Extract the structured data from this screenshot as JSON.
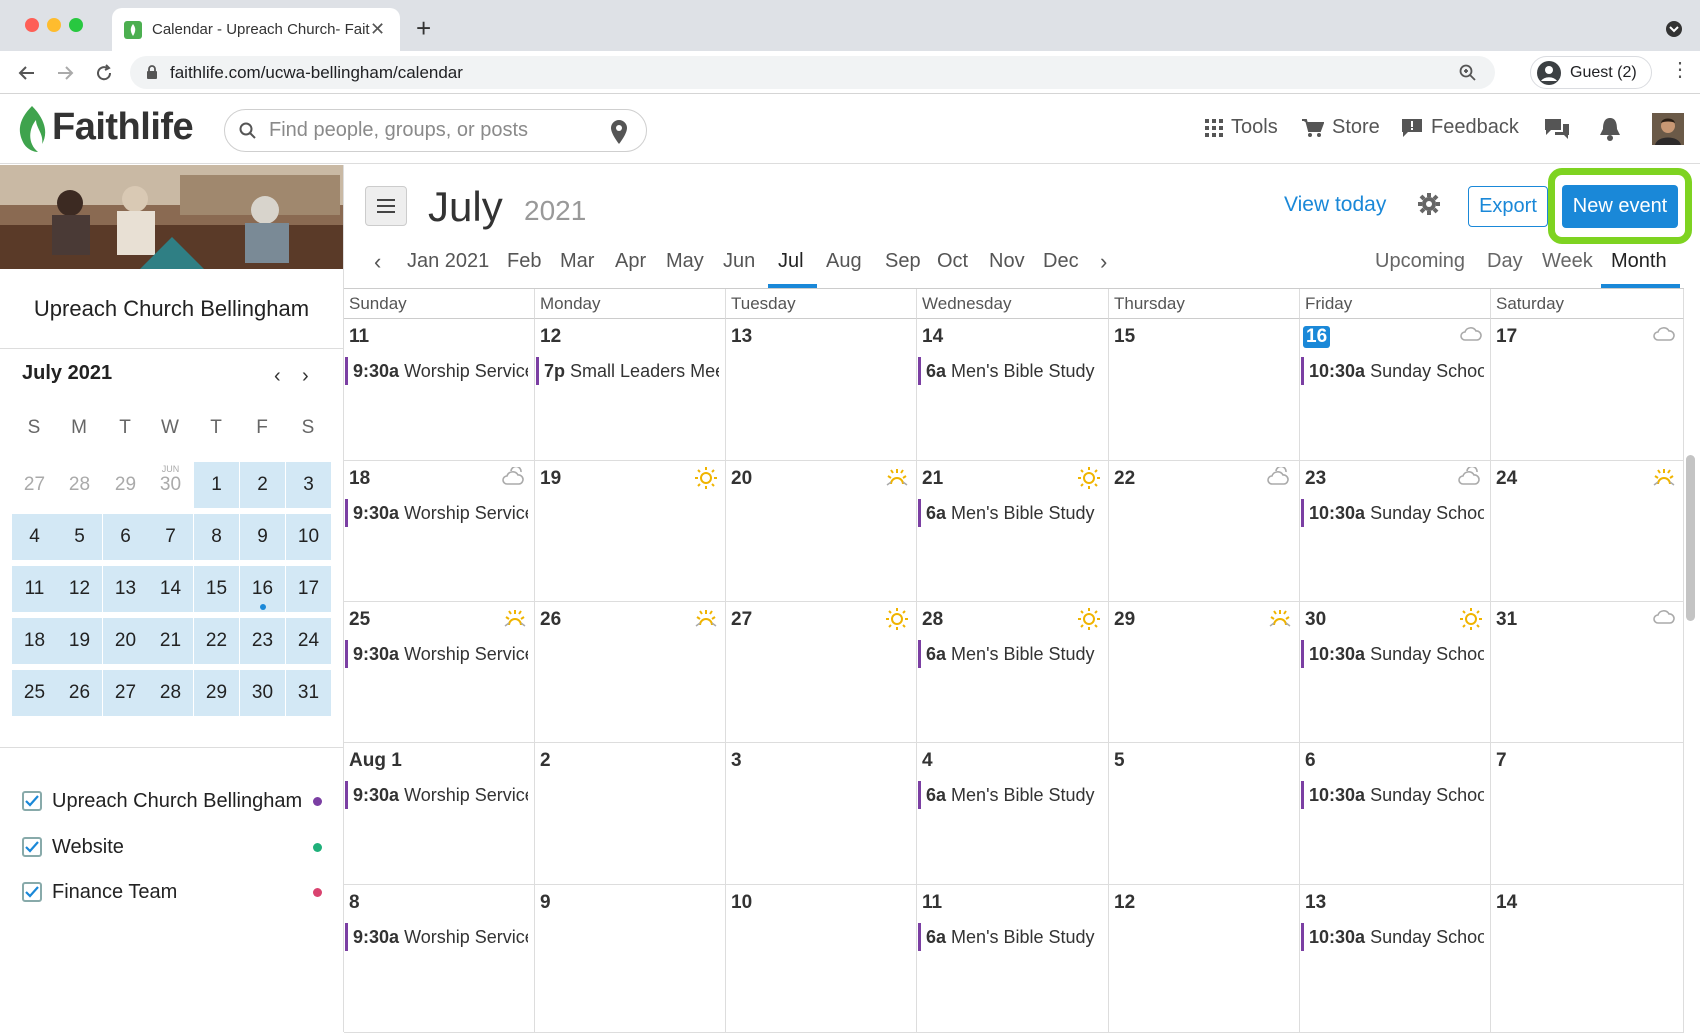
{
  "browser": {
    "tab_title": "Calendar - Upreach Church- Faithlife",
    "url": "faithlife.com/ucwa-bellingham/calendar",
    "guest_label": "Guest (2)"
  },
  "site": {
    "logo": "Faithlife",
    "search_placeholder": "Find people, groups, or posts",
    "nav": {
      "tools": "Tools",
      "store": "Store",
      "feedback": "Feedback"
    },
    "brand_color": "#4caf50",
    "accent_color": "#1a88d8"
  },
  "sidebar": {
    "church_name": "Upreach Church Bellingham",
    "mini_calendar": {
      "title": "July 2021",
      "weekdays": [
        "S",
        "M",
        "T",
        "W",
        "T",
        "F",
        "S"
      ],
      "jun_label": "JUN",
      "weeks": [
        [
          "27",
          "28",
          "29",
          "30",
          "1",
          "2",
          "3"
        ],
        [
          "4",
          "5",
          "6",
          "7",
          "8",
          "9",
          "10"
        ],
        [
          "11",
          "12",
          "13",
          "14",
          "15",
          "16",
          "17"
        ],
        [
          "18",
          "19",
          "20",
          "21",
          "22",
          "23",
          "24"
        ],
        [
          "25",
          "26",
          "27",
          "28",
          "29",
          "30",
          "31"
        ]
      ]
    },
    "calendars": [
      {
        "name": "Upreach Church Bellingham",
        "color": "#7b3fa3",
        "checked": true
      },
      {
        "name": "Website",
        "color": "#1fb07a",
        "checked": true
      },
      {
        "name": "Finance Team",
        "color": "#d9436f",
        "checked": true
      }
    ]
  },
  "calendar": {
    "month": "July",
    "year": "2021",
    "view_today": "View today",
    "export": "Export",
    "new_event": "New event",
    "month_tabs": [
      "Jan 2021",
      "Feb",
      "Mar",
      "Apr",
      "May",
      "Jun",
      "Jul",
      "Aug",
      "Sep",
      "Oct",
      "Nov",
      "Dec"
    ],
    "active_month": "Jul",
    "view_tabs": [
      "Upcoming",
      "Day",
      "Week",
      "Month"
    ],
    "active_view": "Month",
    "weekdays": [
      "Sunday",
      "Monday",
      "Tuesday",
      "Wednesday",
      "Thursday",
      "Friday",
      "Saturday"
    ],
    "weeks": [
      [
        {
          "day": "11",
          "event": {
            "time": "9:30a",
            "title": "Worship Service"
          }
        },
        {
          "day": "12",
          "event": {
            "time": "7p",
            "title": "Small Leaders Meeting"
          }
        },
        {
          "day": "13"
        },
        {
          "day": "14",
          "event": {
            "time": "6a",
            "title": "Men's Bible Study"
          }
        },
        {
          "day": "15"
        },
        {
          "day": "16",
          "today": true,
          "weather": "cloud",
          "event": {
            "time": "10:30a",
            "title": "Sunday School"
          }
        },
        {
          "day": "17",
          "weather": "cloud"
        }
      ],
      [
        {
          "day": "18",
          "weather": "partly-cloudy",
          "event": {
            "time": "9:30a",
            "title": "Worship Service"
          }
        },
        {
          "day": "19",
          "weather": "sun"
        },
        {
          "day": "20",
          "weather": "sunrise"
        },
        {
          "day": "21",
          "weather": "sun",
          "event": {
            "time": "6a",
            "title": "Men's Bible Study"
          }
        },
        {
          "day": "22",
          "weather": "partly-cloudy"
        },
        {
          "day": "23",
          "weather": "partly-cloudy",
          "event": {
            "time": "10:30a",
            "title": "Sunday School"
          }
        },
        {
          "day": "24",
          "weather": "sunrise"
        }
      ],
      [
        {
          "day": "25",
          "weather": "sunrise",
          "event": {
            "time": "9:30a",
            "title": "Worship Service"
          }
        },
        {
          "day": "26",
          "weather": "sunrise"
        },
        {
          "day": "27",
          "weather": "sun"
        },
        {
          "day": "28",
          "weather": "sun",
          "event": {
            "time": "6a",
            "title": "Men's Bible Study"
          }
        },
        {
          "day": "29",
          "weather": "sunrise"
        },
        {
          "day": "30",
          "weather": "sun",
          "event": {
            "time": "10:30a",
            "title": "Sunday School"
          }
        },
        {
          "day": "31",
          "weather": "cloud"
        }
      ],
      [
        {
          "day": "Aug 1",
          "event": {
            "time": "9:30a",
            "title": "Worship Service"
          }
        },
        {
          "day": "2"
        },
        {
          "day": "3"
        },
        {
          "day": "4",
          "event": {
            "time": "6a",
            "title": "Men's Bible Study"
          }
        },
        {
          "day": "5"
        },
        {
          "day": "6",
          "event": {
            "time": "10:30a",
            "title": "Sunday School"
          }
        },
        {
          "day": "7"
        }
      ],
      [
        {
          "day": "8",
          "event": {
            "time": "9:30a",
            "title": "Worship Service"
          }
        },
        {
          "day": "9"
        },
        {
          "day": "10"
        },
        {
          "day": "11",
          "event": {
            "time": "6a",
            "title": "Men's Bible Study"
          }
        },
        {
          "day": "12"
        },
        {
          "day": "13",
          "event": {
            "time": "10:30a",
            "title": "Sunday School"
          }
        },
        {
          "day": "14"
        }
      ]
    ]
  }
}
